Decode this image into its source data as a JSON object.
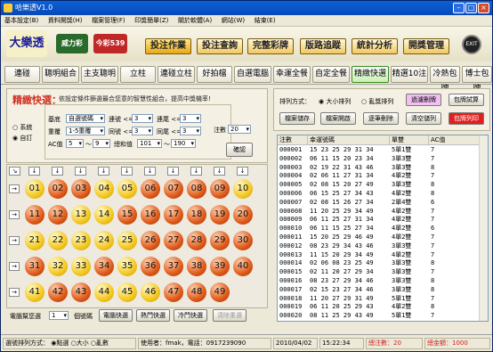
{
  "window": {
    "title": "哈樂透V1.0"
  },
  "menu": [
    "基本設定(B)",
    "資料開獎(H)",
    "檔案管理(F)",
    "印獎簡單(Z)",
    "關於軟體(A)",
    "網站(W)",
    "結束(E)"
  ],
  "banner": {
    "logos": [
      "大樂透",
      "威力彩",
      "今彩539"
    ],
    "buttons": [
      "投注作業",
      "投注查詢",
      "完整彩牌",
      "版路追蹤",
      "統計分析",
      "開獎管理"
    ],
    "exit_label": "EXIT"
  },
  "tabs": [
    "連碰",
    "聰明組合",
    "主支聰明",
    "立柱",
    "連碰立柱",
    "好拍檔",
    "自選電腦",
    "幸運全餐",
    "自定全餐",
    "精緻快選",
    "精選10注",
    "冷熱包牌",
    "博士包牌"
  ],
  "active_tab": "精緻快選",
  "filter": {
    "title": "精緻快選：",
    "hint": "依設定條件篩選最合您意的智慧性組合，提高中獎機率!",
    "mode_options": [
      "系統",
      "自訂"
    ],
    "mode_selected": "自訂",
    "rows": [
      {
        "label1": "基底",
        "val1": "自選號碼",
        "label2": "連號 <=",
        "val2": "3",
        "label3": "連尾 <=",
        "val3": "3"
      },
      {
        "label1": "重覆",
        "val1": "1-5重覆",
        "label2": "同號 <=",
        "val2": "3",
        "label3": "同尾 <=",
        "val3": "3"
      },
      {
        "label1": "AC值",
        "val1": "5",
        "range_sep": "～",
        "val1b": "9",
        "label2": "總和值",
        "val2": "101",
        "val3": "190"
      }
    ],
    "count_label": "注數",
    "count_value": "20",
    "confirm_label": "確認"
  },
  "balls": {
    "red": [
      2,
      3,
      6,
      7,
      8,
      9,
      11,
      12,
      15,
      16,
      17,
      18,
      19,
      20,
      26,
      27,
      28,
      29,
      30,
      31,
      34,
      36,
      37,
      38,
      39,
      40,
      42,
      43,
      47,
      48,
      49
    ],
    "numbers": [
      1,
      2,
      3,
      4,
      5,
      6,
      7,
      8,
      9,
      10,
      11,
      12,
      13,
      14,
      15,
      16,
      17,
      18,
      19,
      20,
      21,
      22,
      23,
      24,
      25,
      26,
      27,
      28,
      29,
      30,
      31,
      32,
      33,
      34,
      35,
      36,
      37,
      38,
      39,
      40,
      41,
      42,
      43,
      44,
      45,
      46,
      47,
      48,
      49
    ]
  },
  "bottom": {
    "label": "電腦幫您選",
    "select_value": "1",
    "unit": "個號碼",
    "buttons": [
      "電腦快選",
      "熱門快選",
      "冷門快選",
      "清除重選"
    ]
  },
  "right_panel": {
    "sort_label": "排列方式：",
    "sort_options": [
      "大小排列",
      "亂獎排列"
    ],
    "sort_selected": "大小排列",
    "buttons_row1": [
      "過濾刪牌",
      "包牌試算"
    ],
    "buttons_row2": [
      "檔案儲存",
      "檔案開啟",
      "逐筆刪除",
      "清空儲列",
      "包牌列印"
    ]
  },
  "table": {
    "headers": [
      "注數",
      "幸運號碼",
      "單雙",
      "AC值"
    ],
    "rows": [
      [
        "000001",
        "15 23 25 29 31 34",
        "5單1雙",
        "7"
      ],
      [
        "000002",
        "06 11 15 20 23 34",
        "3單3雙",
        "7"
      ],
      [
        "000003",
        "02 19 22 31 43 46",
        "3單3雙",
        "8"
      ],
      [
        "000004",
        "02 06 11 27 31 34",
        "4單2雙",
        "7"
      ],
      [
        "000005",
        "02 08 15 20 27 49",
        "3單3雙",
        "8"
      ],
      [
        "000006",
        "06 15 25 27 34 43",
        "4單2雙",
        "8"
      ],
      [
        "000007",
        "02 08 15 26 27 34",
        "2單4雙",
        "6"
      ],
      [
        "000008",
        "11 20 25 29 34 49",
        "4單2雙",
        "7"
      ],
      [
        "000009",
        "06 11 25 27 31 34",
        "4單2雙",
        "7"
      ],
      [
        "000010",
        "06 11 15 25 27 34",
        "4單2雙",
        "6"
      ],
      [
        "000011",
        "15 20 25 29 46 49",
        "4單2雙",
        "7"
      ],
      [
        "000012",
        "08 23 29 34 43 46",
        "3單3雙",
        "7"
      ],
      [
        "000013",
        "11 15 20 29 34 49",
        "4單2雙",
        "7"
      ],
      [
        "000014",
        "02 06 08 23 25 49",
        "3單3雙",
        "8"
      ],
      [
        "000015",
        "02 11 20 27 29 34",
        "3單3雙",
        "7"
      ],
      [
        "000016",
        "08 23 27 29 34 46",
        "3單3雙",
        "8"
      ],
      [
        "000017",
        "02 15 23 27 34 46",
        "3單3雙",
        "8"
      ],
      [
        "000018",
        "11 20 27 29 31 49",
        "5單1雙",
        "7"
      ],
      [
        "000019",
        "06 11 20 25 29 43",
        "4單2雙",
        "8"
      ],
      [
        "000020",
        "08 11 25 29 43 49",
        "5單1雙",
        "7"
      ]
    ]
  },
  "status": {
    "sort_label": "選號排列方式：",
    "sort_options": [
      "點選",
      "大小",
      "亂數"
    ],
    "sort_selected": "點選",
    "user": "使用者：fmak，電話：0917239090",
    "date": "2010/04/02",
    "time": "15:22:34",
    "total_label": "總注數：20",
    "amount_label": "總金額：1000"
  },
  "colors": {
    "active_tab": "#c8f0b0",
    "ball_yellow": "#f4c820",
    "ball_red": "#e05a18",
    "print_button": "#e02020",
    "filter_button": "#f0c0f0"
  }
}
